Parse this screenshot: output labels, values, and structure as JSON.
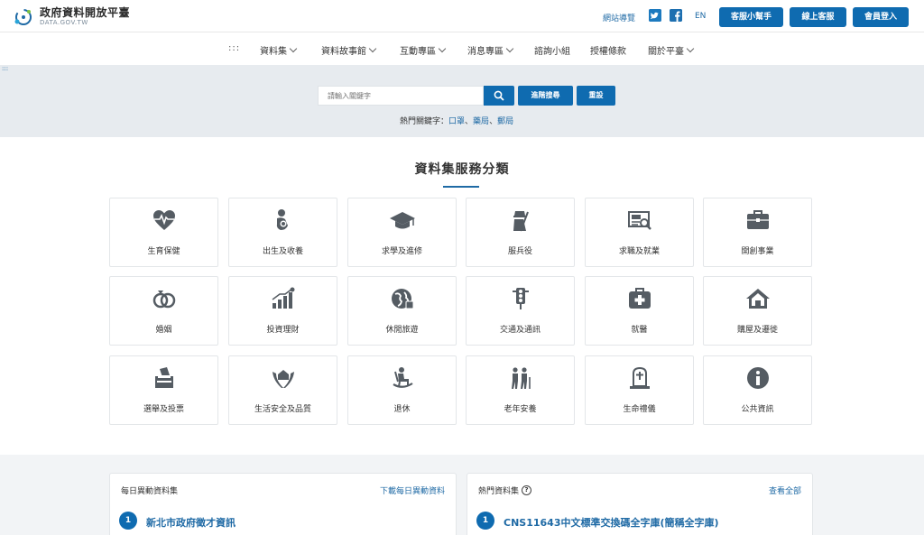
{
  "header": {
    "logo_title": "政府資料開放平臺",
    "logo_sub": "DATA.GOV.TW",
    "sitemap": "網站導覽",
    "lang": "EN",
    "btn_helper": "客服小幫手",
    "btn_online": "線上客服",
    "btn_login": "會員登入"
  },
  "nav": {
    "grid": ":::",
    "items": [
      "資料集",
      "資料故事館",
      "互動專區",
      "消息專區",
      "諮詢小組",
      "授權條款",
      "關於平臺"
    ]
  },
  "search": {
    "placeholder": "請輸入關鍵字",
    "advanced": "進階搜尋",
    "reset": "重設",
    "hot_label": "熱門關鍵字：",
    "hot_keywords": [
      "口罩",
      "藥局",
      "郵局"
    ],
    "sep": "、"
  },
  "categories": {
    "title": "資料集服務分類",
    "items": [
      {
        "label": "生育保健",
        "icon": "heart-pulse-icon"
      },
      {
        "label": "出生及收養",
        "icon": "baby-icon"
      },
      {
        "label": "求學及進修",
        "icon": "graduation-cap-icon"
      },
      {
        "label": "服兵役",
        "icon": "soldier-icon"
      },
      {
        "label": "求職及就業",
        "icon": "job-board-icon"
      },
      {
        "label": "開創事業",
        "icon": "briefcase-icon"
      },
      {
        "label": "婚姻",
        "icon": "rings-icon"
      },
      {
        "label": "投資理財",
        "icon": "chart-growth-icon"
      },
      {
        "label": "休閒旅遊",
        "icon": "globe-travel-icon"
      },
      {
        "label": "交通及通訊",
        "icon": "traffic-light-icon"
      },
      {
        "label": "就醫",
        "icon": "medical-kit-icon"
      },
      {
        "label": "購屋及遷徙",
        "icon": "house-icon"
      },
      {
        "label": "選舉及投票",
        "icon": "ballot-box-icon"
      },
      {
        "label": "生活安全及品質",
        "icon": "hands-house-icon"
      },
      {
        "label": "退休",
        "icon": "rocking-chair-icon"
      },
      {
        "label": "老年安養",
        "icon": "elderly-icon"
      },
      {
        "label": "生命禮儀",
        "icon": "tombstone-icon"
      },
      {
        "label": "公共資訊",
        "icon": "info-icon"
      }
    ]
  },
  "daily": {
    "title": "每日異動資料集",
    "link": "下載每日異動資料",
    "first_num": "1",
    "first_item": "新北市政府徵才資訊"
  },
  "popular": {
    "title": "熱門資料集",
    "link": "查看全部",
    "first_num": "1",
    "first_item": "CNS11643中文標準交換碼全字庫(簡稱全字庫)"
  },
  "colors": {
    "primary": "#0f6bb0",
    "link": "#1f6aa5",
    "icon": "#555c63"
  }
}
